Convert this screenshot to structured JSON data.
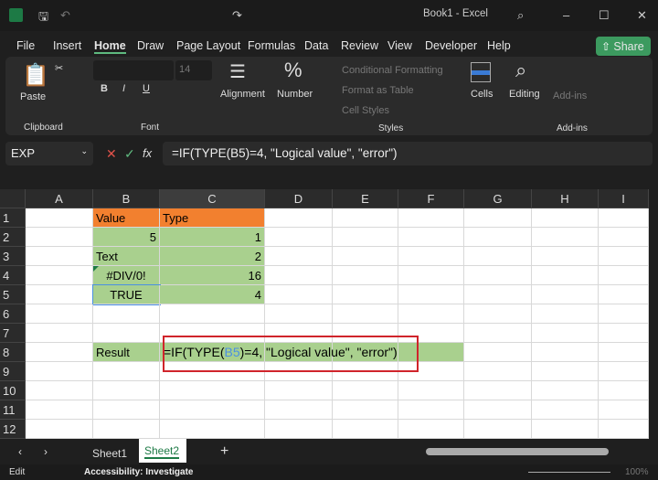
{
  "title": "Book1 - Excel",
  "menu": [
    "File",
    "Insert",
    "Home",
    "Draw",
    "Page Layout",
    "Formulas",
    "Data",
    "Review",
    "View",
    "Developer",
    "Help"
  ],
  "share": "Share",
  "ribbon": {
    "paste": "Paste",
    "clipboard": "Clipboard",
    "font_size": "14",
    "font": "Font",
    "alignment": "Alignment",
    "number": "Number",
    "cond_format": "Conditional Formatting",
    "format_table": "Format as Table",
    "cell_styles": "Cell Styles",
    "styles": "Styles",
    "cells": "Cells",
    "editing": "Editing",
    "addins": "Add-ins",
    "addins_group": "Add-ins"
  },
  "formula_bar": {
    "name_box": "EXP",
    "fx": "fx",
    "formula": "=IF(TYPE(B5)=4, \"Logical value\", \"error\")"
  },
  "columns": [
    "A",
    "B",
    "C",
    "D",
    "E",
    "F",
    "G",
    "H",
    "I"
  ],
  "rows": [
    "1",
    "2",
    "3",
    "4",
    "5",
    "6",
    "7",
    "8",
    "9",
    "10",
    "11",
    "12"
  ],
  "cells": {
    "B1": "Value",
    "C1": "Type",
    "B2": "5",
    "C2": "1",
    "B3": "Text",
    "C3": "2",
    "B4": "#DIV/0!",
    "C4": "16",
    "B5": "TRUE",
    "C5": "4",
    "B8": "Result",
    "C8_a": "=IF(TYPE(",
    "C8_ref": "B5",
    "C8_b": ")=4, \"Logical value\", \"error\")"
  },
  "sheets": [
    "Sheet1",
    "Sheet2"
  ],
  "status": {
    "mode": "Edit",
    "accessibility": "Accessibility: Investigate",
    "zoom": "100%"
  }
}
